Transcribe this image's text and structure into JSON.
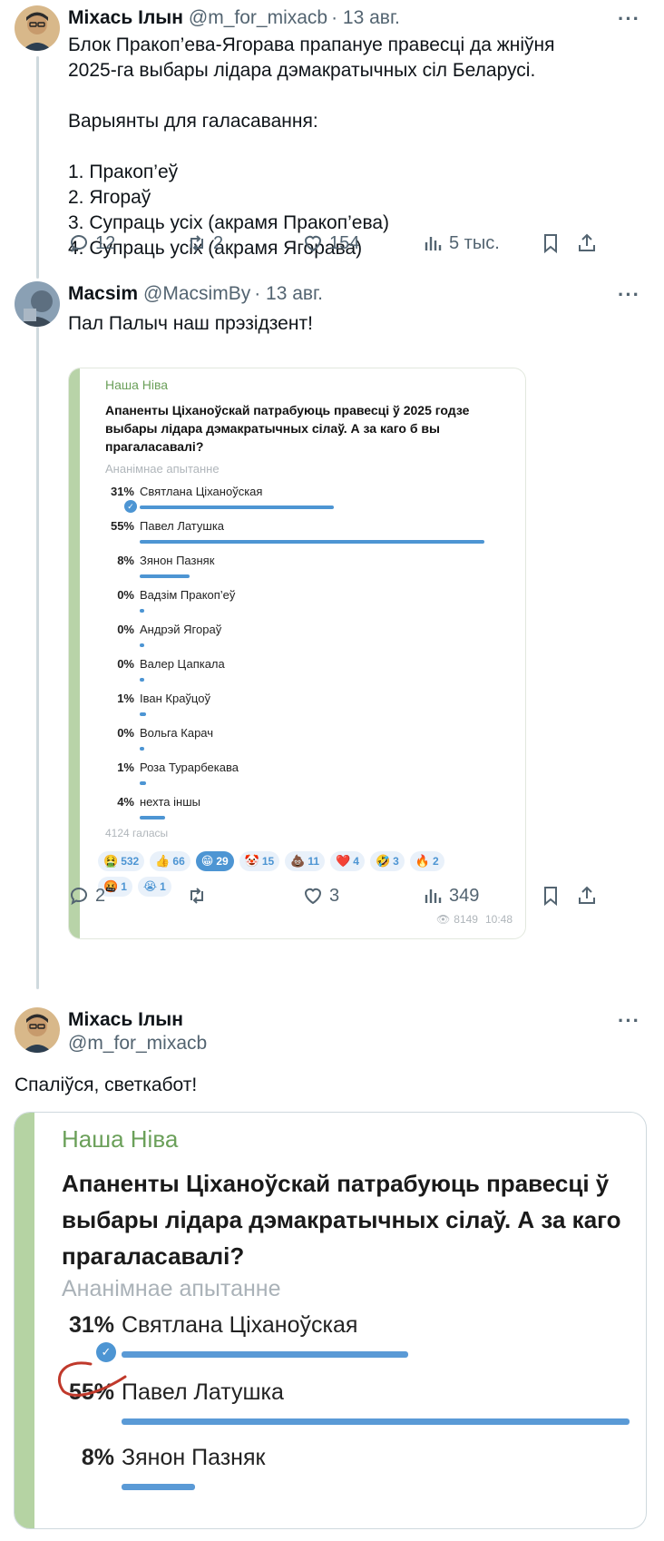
{
  "tweet1": {
    "name": "Міхась Ілын",
    "handle": "@m_for_mixacb",
    "date": "· 13 авг.",
    "more": "···",
    "lines": [
      "Блок Пракоп’ева-Ягорава прапануе правесці да жніўня",
      "2025-га выбары лідара дэмакратычных сіл Беларусі.",
      "",
      "Варыянты для галасавання:",
      "",
      "1. Пракоп’еў",
      "2. Ягораў",
      "3. Супраць усіх (акрамя Пракоп’ева)",
      "4. Супраць усіх (акрамя Ягорава)"
    ],
    "replies": "12",
    "retweets": "2",
    "likes": "154",
    "views": "5 тыс."
  },
  "tweet2": {
    "name": "Macsim",
    "handle": "@MacsimBy",
    "date": "· 13 авг.",
    "more": "···",
    "text": "Пал Палыч наш прэзідзент!",
    "replies": "2",
    "retweets": "",
    "likes": "3",
    "views": "349"
  },
  "poll_small": {
    "source": "Наша Ніва",
    "question": "Апаненты Ціханоўскай патрабуюць правесці ў 2025 годзе выбары лідара дэмакратычных сілаў. А за каго б вы прагаласавалі?",
    "anon": "Ананімнае апытанне",
    "options": [
      {
        "pct": "31%",
        "label": "Святлана Ціханоўская",
        "value": 31,
        "checked": true
      },
      {
        "pct": "55%",
        "label": "Павел Латушка",
        "value": 55,
        "checked": false
      },
      {
        "pct": "8%",
        "label": "Зянон Пазняк",
        "value": 8,
        "checked": false
      },
      {
        "pct": "0%",
        "label": "Вадзім Пракоп’еў",
        "value": 0,
        "checked": false
      },
      {
        "pct": "0%",
        "label": "Андрэй Ягораў",
        "value": 0,
        "checked": false
      },
      {
        "pct": "0%",
        "label": "Валер Цапкала",
        "value": 0,
        "checked": false
      },
      {
        "pct": "1%",
        "label": "Іван Краўцоў",
        "value": 1,
        "checked": false
      },
      {
        "pct": "0%",
        "label": "Вольга Карач",
        "value": 0,
        "checked": false
      },
      {
        "pct": "1%",
        "label": "Роза Турарбекава",
        "value": 1,
        "checked": false
      },
      {
        "pct": "4%",
        "label": "нехта іншы",
        "value": 4,
        "checked": false
      }
    ],
    "votes": "4124 галасы",
    "reactions_row1": [
      {
        "emoji": "🤮",
        "count": "532",
        "sel": false
      },
      {
        "emoji": "👍",
        "count": "66",
        "sel": false
      },
      {
        "emoji": "😁",
        "count": "29",
        "sel": true
      },
      {
        "emoji": "🤡",
        "count": "15",
        "sel": false
      },
      {
        "emoji": "💩",
        "count": "11",
        "sel": false
      },
      {
        "emoji": "❤️",
        "count": "4",
        "sel": false
      },
      {
        "emoji": "🤣",
        "count": "3",
        "sel": false
      },
      {
        "emoji": "🔥",
        "count": "2",
        "sel": false
      }
    ],
    "reactions_row2": [
      {
        "emoji": "🤬",
        "count": "1",
        "sel": false
      },
      {
        "emoji": "😭",
        "count": "1",
        "sel": false
      }
    ],
    "views": "8149",
    "time": "10:48"
  },
  "tweet3": {
    "name": "Міхась Ілын",
    "handle": "@m_for_mixacb",
    "more": "···",
    "text": "Спаліўся, светкабот!"
  },
  "poll_big": {
    "source": "Наша Ніва",
    "q_line1": "Апаненты Ціханоўскай патрабуюць правесці ў",
    "q_line2": "выбары лідара дэмакратычных сілаў. А за каго",
    "q_line3": "прагаласавалі?",
    "anon": "Ананімнае апытанне",
    "options": [
      {
        "pct": "31%",
        "label": "Святлана Ціханоўская",
        "value": 31
      },
      {
        "pct": "55%",
        "label": "Павел Латушка",
        "value": 55
      },
      {
        "pct": "8%",
        "label": "Зянон Пазняк",
        "value": 8
      }
    ]
  },
  "colors": {
    "accent": "#4d95d3",
    "telegram_green": "#6ba05a",
    "muted": "#536471",
    "annotation": "#c0392b"
  }
}
